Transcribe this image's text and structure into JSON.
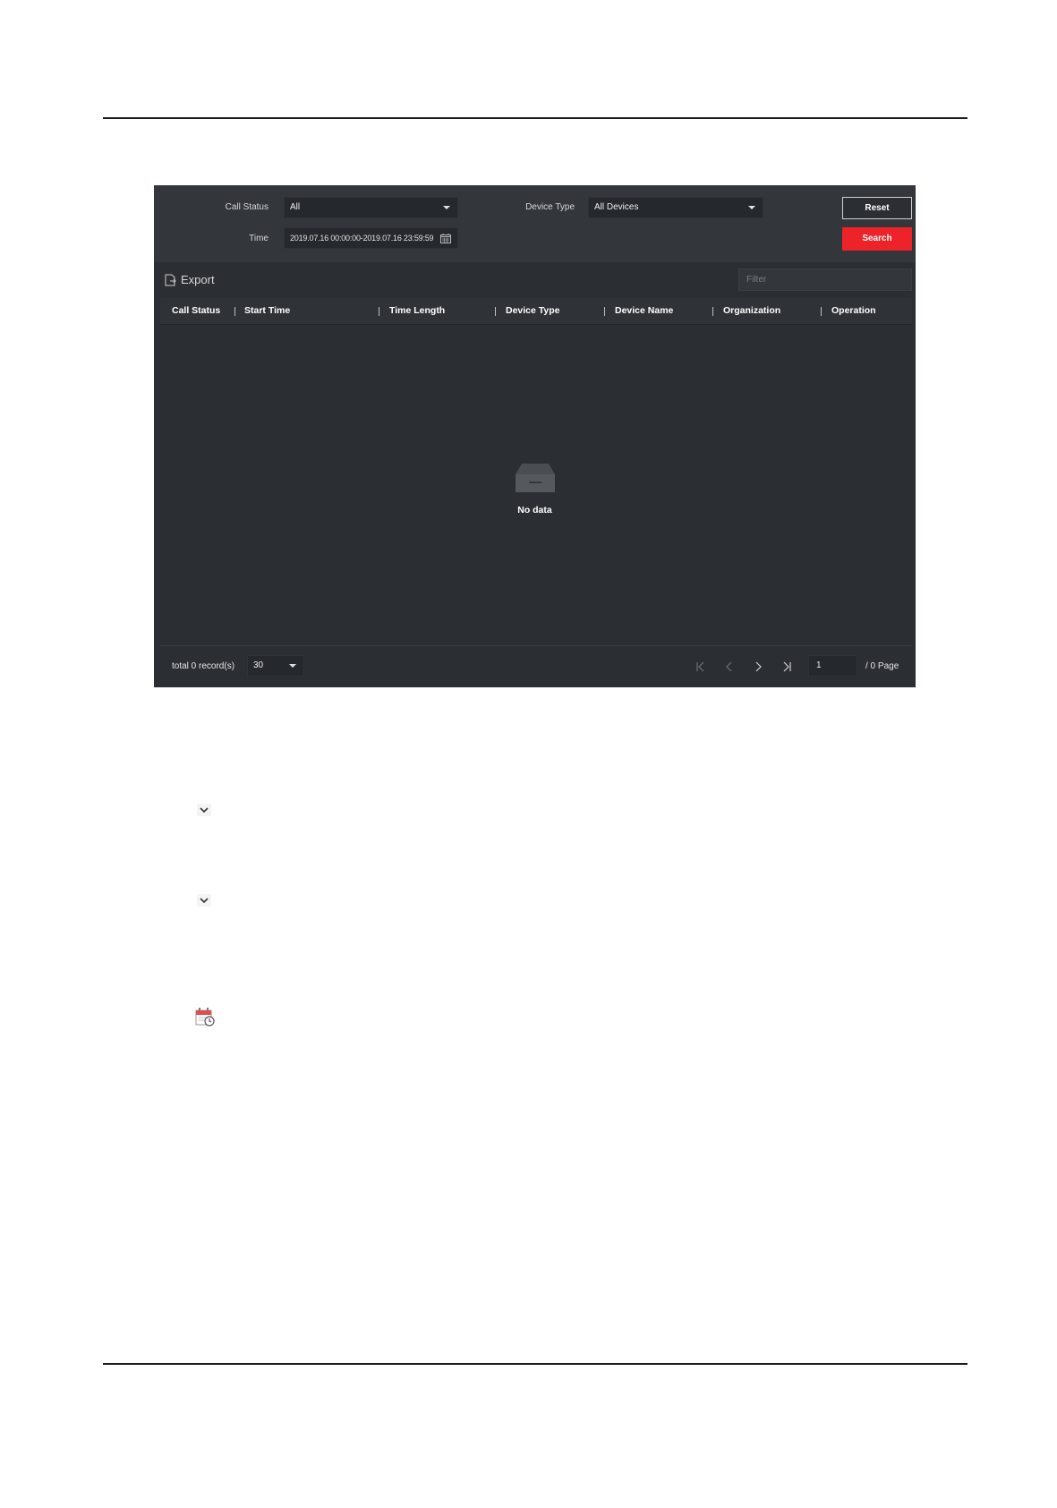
{
  "filters": {
    "call_status_label": "Call Status",
    "call_status_value": "All",
    "device_type_label": "Device Type",
    "device_type_value": "All Devices",
    "time_label": "Time",
    "time_value": "2019.07.16 00:00:00-2019.07.16 23:59:59",
    "reset_label": "Reset",
    "search_label": "Search"
  },
  "actions": {
    "export_label": "Export",
    "filter_placeholder": "Filter"
  },
  "table": {
    "columns": [
      "Call Status",
      "Start Time",
      "Time Length",
      "Device Type",
      "Device Name",
      "Organization",
      "Operation"
    ],
    "rows": [],
    "empty_text": "No data"
  },
  "pagination": {
    "total_text": "total 0 record(s)",
    "page_size": "30",
    "current_page": "1",
    "page_total_text": "/ 0 Page"
  },
  "colors": {
    "panel_bg": "#2b2e33",
    "toolbar_bg": "#33363b",
    "accent_red": "#ee2229"
  },
  "icons": [
    "export-icon",
    "calendar-icon",
    "empty-box-icon",
    "first-page-icon",
    "prev-page-icon",
    "next-page-icon",
    "last-page-icon",
    "chevron-down-icon",
    "calendar-clock-icon"
  ]
}
